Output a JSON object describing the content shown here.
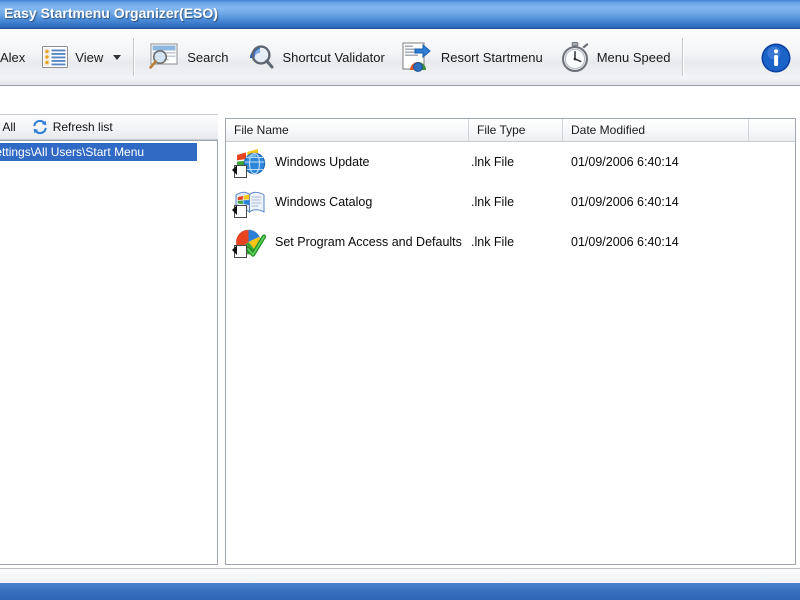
{
  "window": {
    "title": "Easy Startmenu Organizer(ESO)"
  },
  "toolbar": {
    "items": [
      {
        "label": "Alex",
        "icon": "user-icon",
        "has_caret": false
      },
      {
        "label": "View",
        "icon": "list-view-icon",
        "has_caret": true
      },
      {
        "label": "Search",
        "icon": "search-document-icon",
        "has_caret": false
      },
      {
        "label": "Shortcut Validator",
        "icon": "magnifier-icon",
        "has_caret": false
      },
      {
        "label": "Resort Startmenu",
        "icon": "resort-startmenu-icon",
        "has_caret": false
      },
      {
        "label": "Menu Speed",
        "icon": "stopwatch-icon",
        "has_caret": false
      }
    ],
    "info_label": "",
    "info_icon": "info-icon"
  },
  "left_panel": {
    "toolbar": {
      "collapse_all_label": "se All",
      "collapse_all_icon": "collapse-all-icon",
      "refresh_label": "Refresh list",
      "refresh_icon": "refresh-icon"
    },
    "tree": {
      "selected_item": "and Settings\\All Users\\Start Menu"
    }
  },
  "file_list": {
    "columns": [
      {
        "key": "name",
        "label": "File Name"
      },
      {
        "key": "type",
        "label": "File Type"
      },
      {
        "key": "date",
        "label": "Date Modified"
      },
      {
        "key": "extra",
        "label": ""
      }
    ],
    "rows": [
      {
        "name": "Windows Update",
        "type": ".lnk File",
        "date": "01/09/2006 6:40:14",
        "icon": "windows-update-shortcut-icon"
      },
      {
        "name": "Windows Catalog",
        "type": ".lnk File",
        "date": "01/09/2006 6:40:14",
        "icon": "windows-catalog-shortcut-icon"
      },
      {
        "name": "Set Program Access and Defaults",
        "type": ".lnk File",
        "date": "01/09/2006 6:40:14",
        "icon": "set-program-access-shortcut-icon"
      }
    ]
  },
  "colors": {
    "titlebar_blue": "#4a8ad6",
    "selection_blue": "#316ac5",
    "accent_blue": "#1c63c8",
    "toolbar_bg": "#f2f3f6"
  }
}
